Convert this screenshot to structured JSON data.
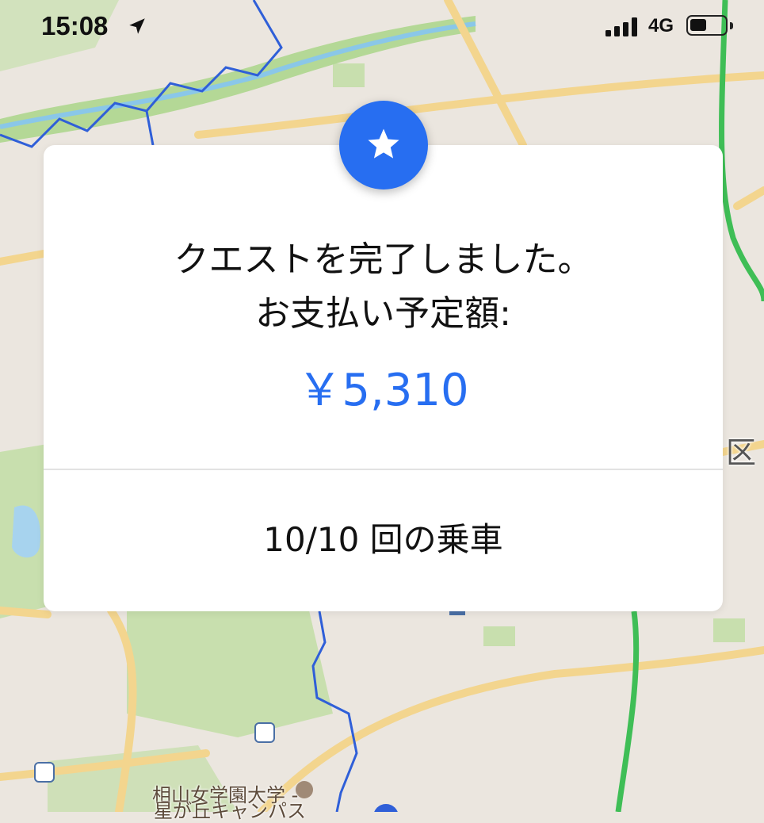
{
  "status_bar": {
    "time": "15:08",
    "network": "4G",
    "location_icon": "location-arrow-icon",
    "signal_icon": "cellular-signal-icon",
    "battery_icon": "battery-icon"
  },
  "card": {
    "badge_icon": "star-icon",
    "title_line1": "クエストを完了しました。",
    "title_line2": "お支払い予定額:",
    "amount": "￥5,310",
    "rides": "10/10 回の乗車"
  },
  "map": {
    "label_university_line1": "相山女学園大学 -",
    "label_university_line2": "星が丘キャンパス",
    "label_ward": "区"
  },
  "colors": {
    "accent": "#276ef1",
    "map_bg": "#ebe6df",
    "road": "#f3d58e",
    "park": "#c8dfae",
    "water": "#a7d3ee",
    "route_blue": "#2f5fd8",
    "route_green": "#3fbe56"
  }
}
